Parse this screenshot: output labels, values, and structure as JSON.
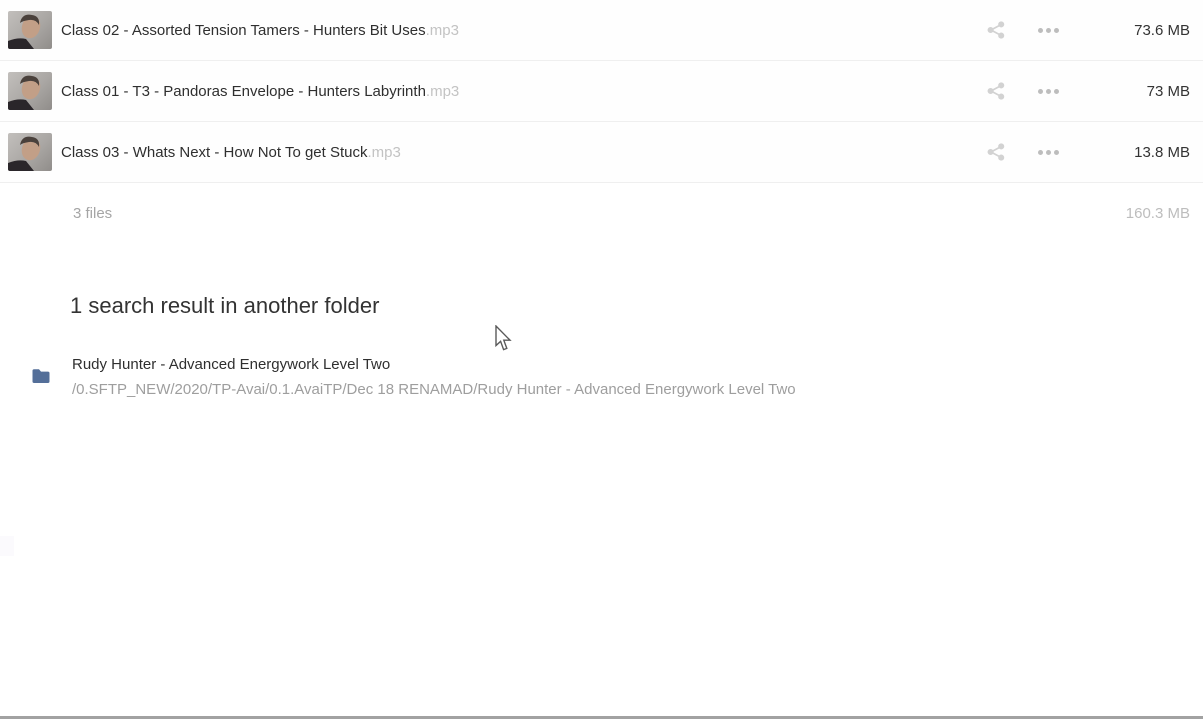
{
  "files": [
    {
      "name": "Class 02 - Assorted Tension Tamers - Hunters Bit Uses",
      "ext": ".mp3",
      "size": "73.6 MB"
    },
    {
      "name": "Class 01 - T3 - Pandoras Envelope - Hunters Labyrinth",
      "ext": ".mp3",
      "size": "73 MB"
    },
    {
      "name": "Class 03 - Whats Next - How Not To get Stuck",
      "ext": ".mp3",
      "size": "13.8 MB"
    }
  ],
  "summary": {
    "file_count": "3 files",
    "total_size": "160.3 MB"
  },
  "search": {
    "heading": "1 search result in another folder",
    "result": {
      "title": "Rudy Hunter - Advanced Energywork Level Two",
      "path": "/0.SFTP_NEW/2020/TP-Avai/0.1.AvaiTP/Dec 18 RENAMAD/Rudy Hunter - Advanced Energywork Level Two"
    }
  },
  "icons": {
    "share": "share-icon",
    "more": "more-options-icon",
    "folder": "folder-icon",
    "cursor": "mouse-cursor"
  },
  "colors": {
    "folder_icon": "#546f99",
    "text_primary": "#2f2f2f",
    "text_muted": "#9e9e9e",
    "text_faint": "#c3c3c3",
    "icon_gray": "#d2d2d2",
    "separator": "#efefef"
  }
}
